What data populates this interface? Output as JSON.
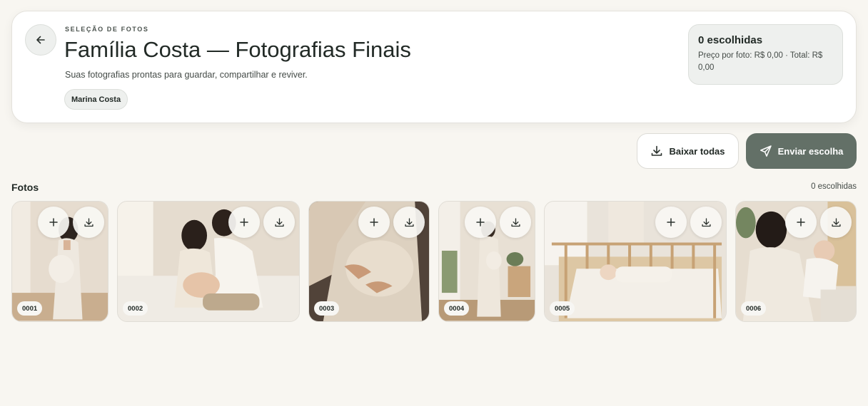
{
  "header": {
    "eyebrow": "SELEÇÃO DE FOTOS",
    "title": "Família Costa — Fotografias Finais",
    "subtitle": "Suas fotografias prontas para guardar, compartilhar e reviver.",
    "client": "Marina Costa",
    "back_icon": "arrow-left-icon"
  },
  "summary": {
    "count": "0 escolhidas",
    "price": "Preço por foto: R$ 0,00 · Total: R$ 0,00"
  },
  "actions": {
    "download_all": "Baixar todas",
    "send": "Enviar escolha"
  },
  "gallery": {
    "title": "Fotos",
    "count": "0 escolhidas",
    "photos": [
      {
        "id": "0001"
      },
      {
        "id": "0002"
      },
      {
        "id": "0003"
      },
      {
        "id": "0004"
      },
      {
        "id": "0005"
      },
      {
        "id": "0006"
      }
    ]
  },
  "colors": {
    "background": "#f8f6f1",
    "accent": "#637067",
    "chip": "#eef0ee"
  }
}
